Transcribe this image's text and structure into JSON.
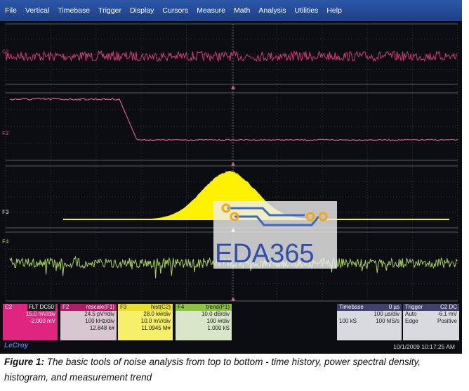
{
  "menu": [
    "File",
    "Vertical",
    "Timebase",
    "Trigger",
    "Display",
    "Cursors",
    "Measure",
    "Math",
    "Analysis",
    "Utilities",
    "Help"
  ],
  "traces": {
    "c2": {
      "label": "C2",
      "color": "#cf3a78"
    },
    "f2": {
      "label": "F2",
      "color": "#d65a8f"
    },
    "f3": {
      "label": "F3",
      "color": "#fff200"
    },
    "f4": {
      "label": "F4",
      "color": "#a6d25a"
    }
  },
  "info": {
    "c2": {
      "name": "C2",
      "tag": "FLT DC50",
      "r1": "15.0 mV/div",
      "r2": "-2.000 mV"
    },
    "f2": {
      "name": "F2",
      "func": "rescale(F1)",
      "r1": "24.5 pV²/div",
      "r2": "100 kHz/div",
      "r3": "12.848 k#"
    },
    "f3": {
      "name": "F3",
      "func": "hist(C2)",
      "r1": "28.0 k#/div",
      "r2": "10.0 mV/div",
      "r3": "11.0945 M#"
    },
    "f4": {
      "name": "F4",
      "func": "trend(P1)",
      "r1": "10.0 dB/div",
      "r2": "100 #/div",
      "r3": "1.000 kS"
    },
    "timebase": {
      "title": "Timebase",
      "value": "0 µs",
      "r1": "100 µs/div",
      "r2a": "100 kS",
      "r2b": "100 MS/s"
    },
    "trigger": {
      "title": "Trigger",
      "badge": "C2 DC",
      "r1a": "Auto",
      "r1b": "-6.1 mV",
      "r2a": "Edge",
      "r2b": "Positive"
    }
  },
  "brand": "LeCroy",
  "timestamp": "10/1/2009 10:17:25 AM",
  "watermark": "EDA365",
  "caption": {
    "fig": "Figure 1:",
    "text": "The basic tools of noise analysis from top to bottom - time history, power spectral density, histogram, and measurement trend"
  }
}
